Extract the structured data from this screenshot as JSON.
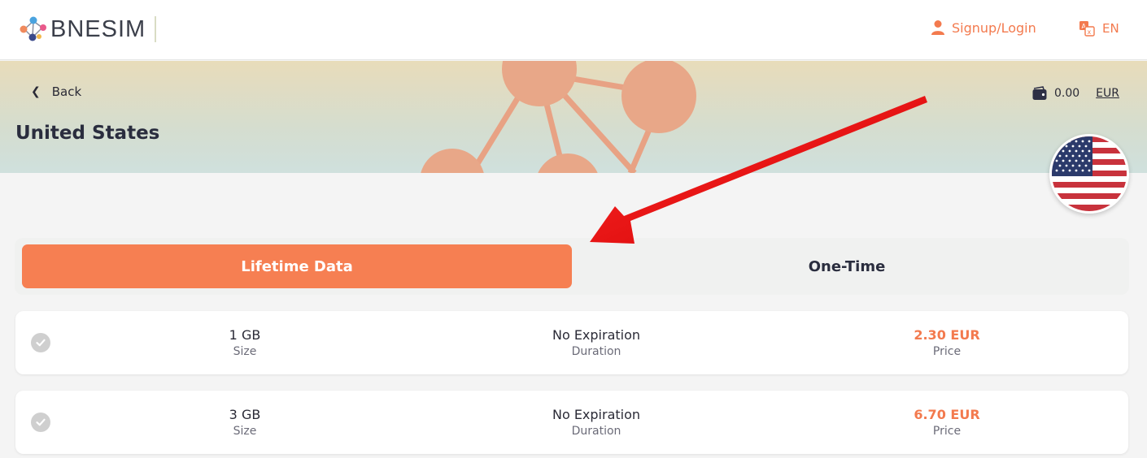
{
  "header": {
    "logo_text": "BNESIM",
    "signup_label": "Signup/Login",
    "lang_label": "EN"
  },
  "banner": {
    "back_label": "Back",
    "title": "United States",
    "wallet_amount": "0.00",
    "wallet_currency": "EUR"
  },
  "tabs": [
    {
      "label": "Lifetime Data",
      "active": true
    },
    {
      "label": "One-Time",
      "active": false
    }
  ],
  "plans": [
    {
      "size": "1 GB",
      "size_label": "Size",
      "duration": "No Expiration",
      "duration_label": "Duration",
      "price": "2.30 EUR",
      "price_label": "Price"
    },
    {
      "size": "3 GB",
      "size_label": "Size",
      "duration": "No Expiration",
      "duration_label": "Duration",
      "price": "6.70 EUR",
      "price_label": "Price"
    }
  ],
  "colors": {
    "accent": "#f67f52",
    "annotation_arrow": "#e30000"
  },
  "icons": [
    "bnesim-logo-icon",
    "user-icon",
    "translate-icon",
    "chevron-left-icon",
    "wallet-icon",
    "us-flag-icon",
    "check-icon"
  ]
}
